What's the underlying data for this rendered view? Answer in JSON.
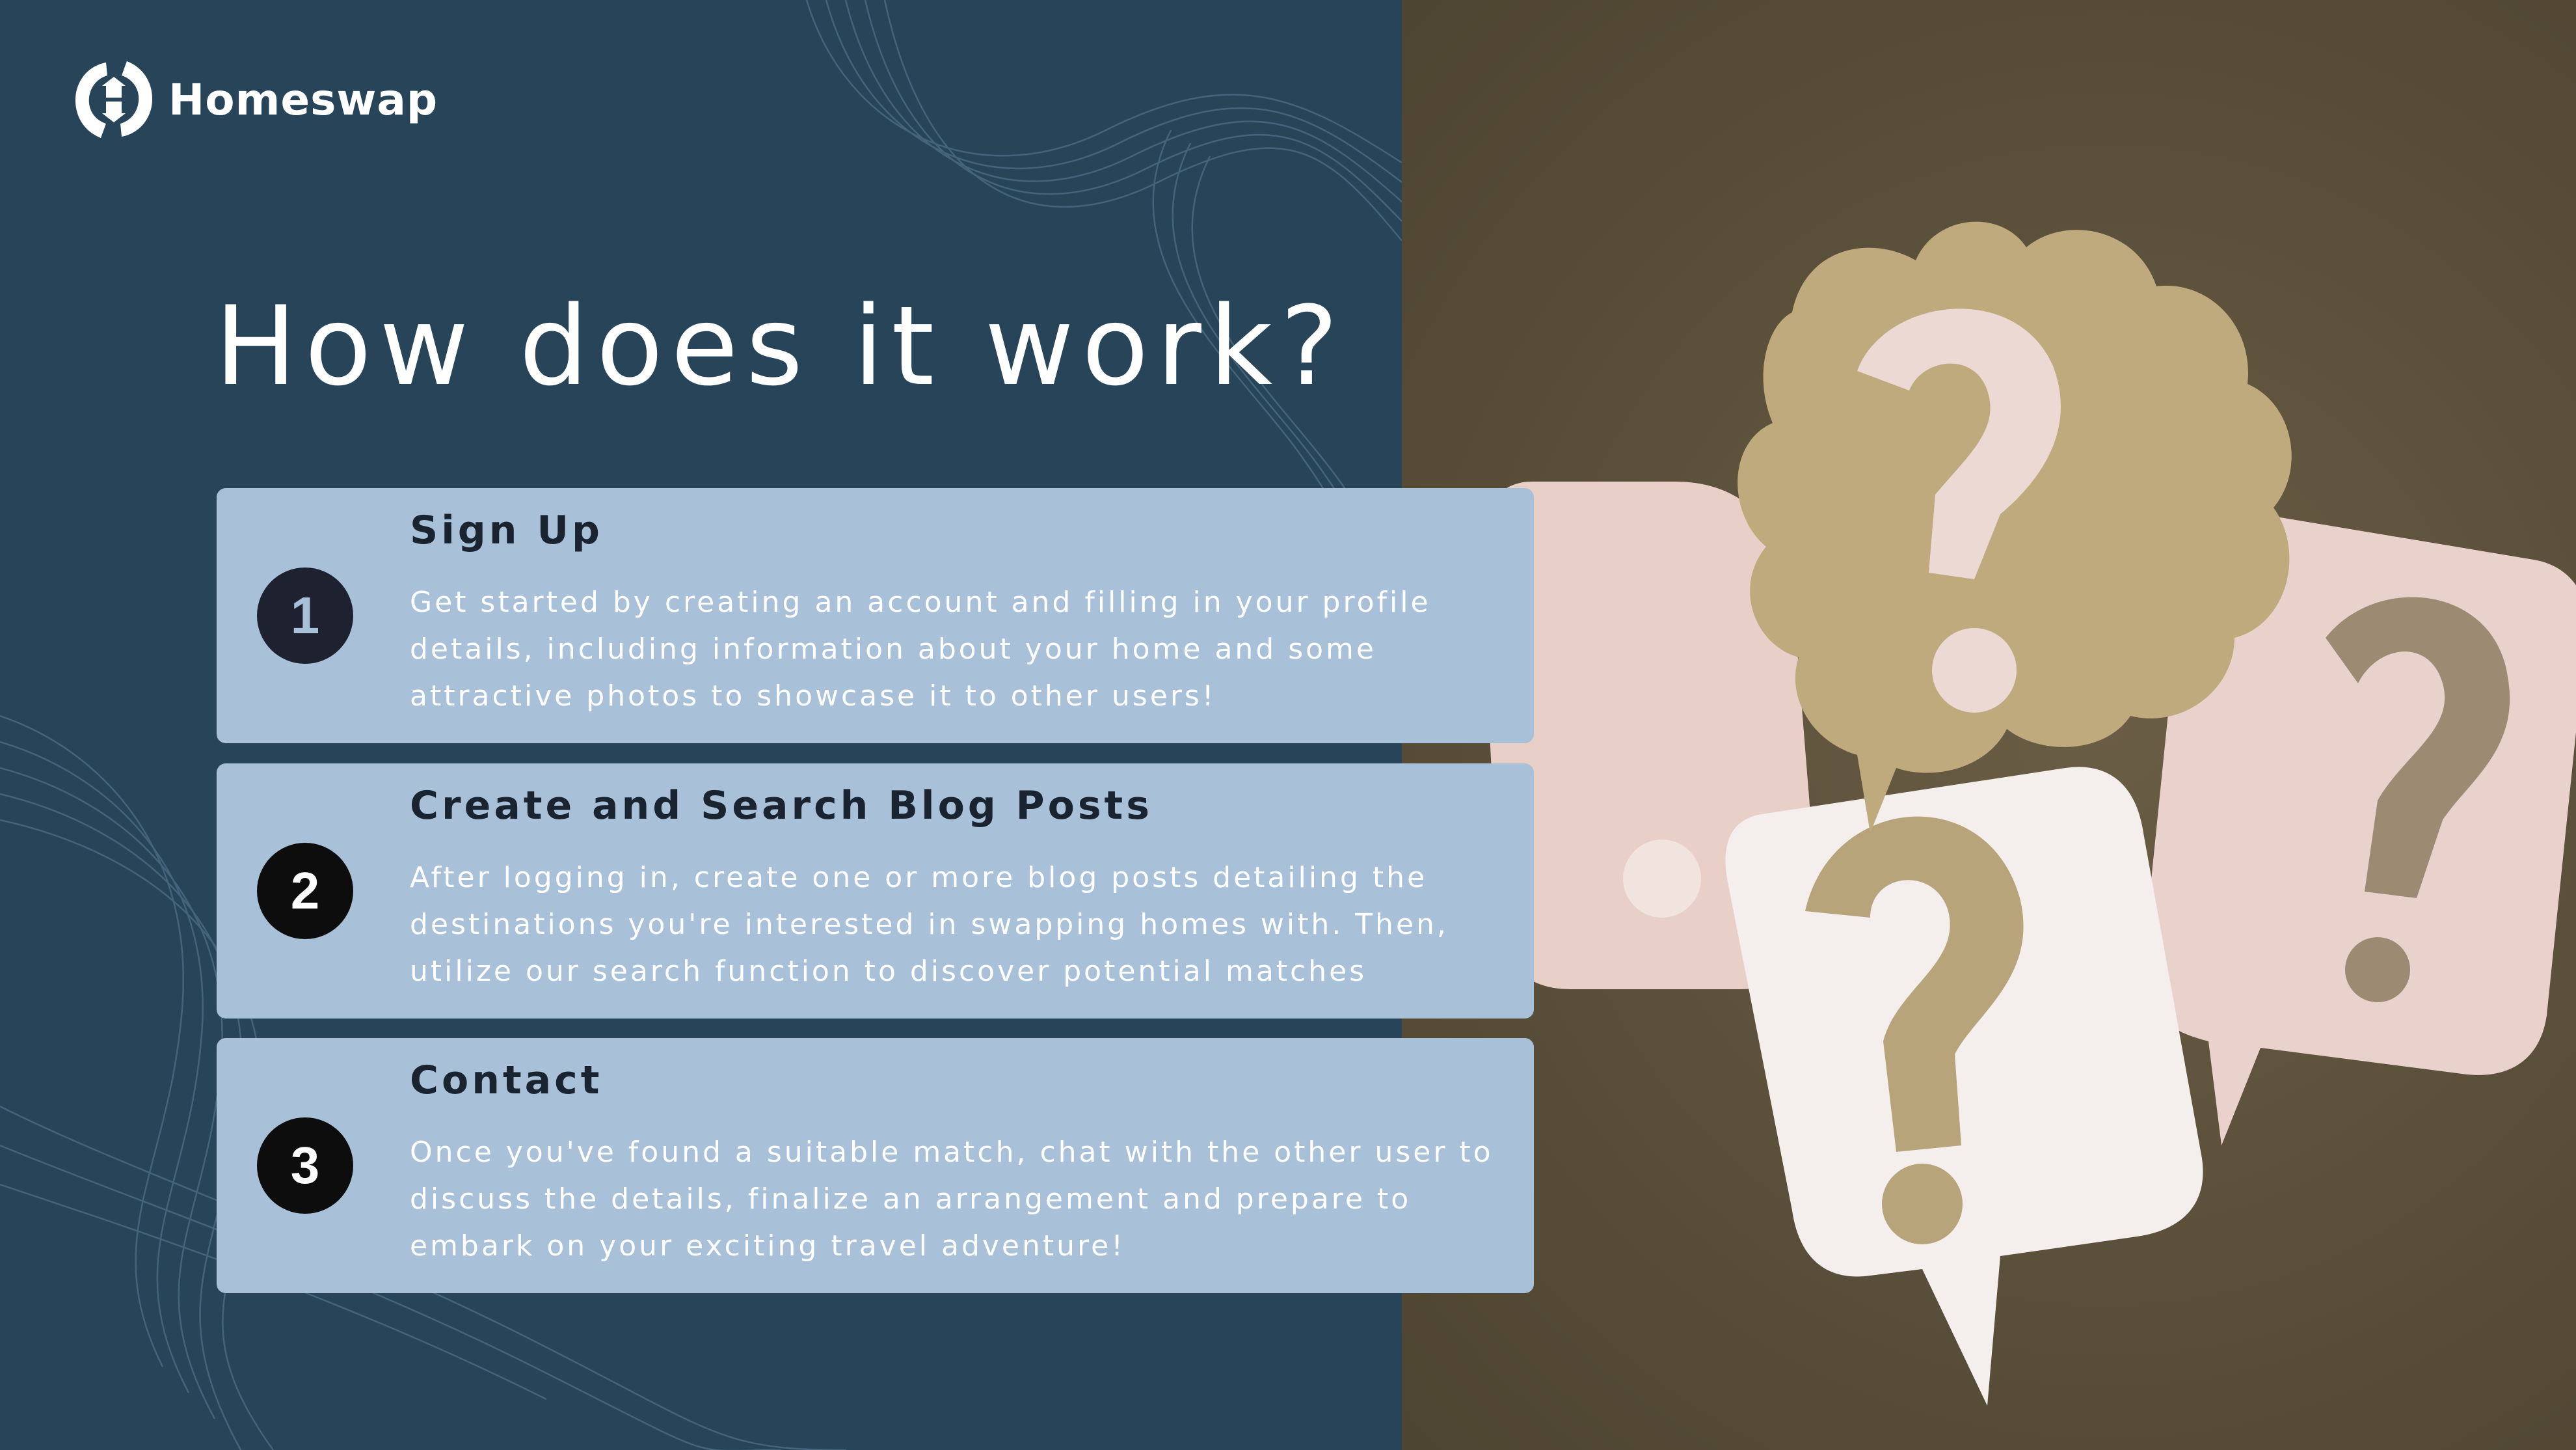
{
  "brand": {
    "name": "Homeswap",
    "logo_icon": "homeswap-logo-icon"
  },
  "heading": "How does it work?",
  "steps": [
    {
      "number": "1",
      "title": "Sign Up",
      "description": "Get started by creating an account and filling in your profile details, including information about your home and some attractive photos to showcase it to other users!"
    },
    {
      "number": "2",
      "title": "Create and Search Blog Posts",
      "description": "After logging in, create one or more blog posts detailing the destinations you're interested in swapping homes with. Then, utilize our search function to discover potential matches"
    },
    {
      "number": "3",
      "title": "Contact",
      "description": "Once you've found a suitable match, chat with the other user to discuss the details, finalize an arrangement and prepare to embark on your exciting travel adventure!"
    }
  ],
  "colors": {
    "background": "#274459",
    "card": "#a8c1d8",
    "badge": "#0d0d0d",
    "photo_backdrop": "#5a4f3a"
  }
}
